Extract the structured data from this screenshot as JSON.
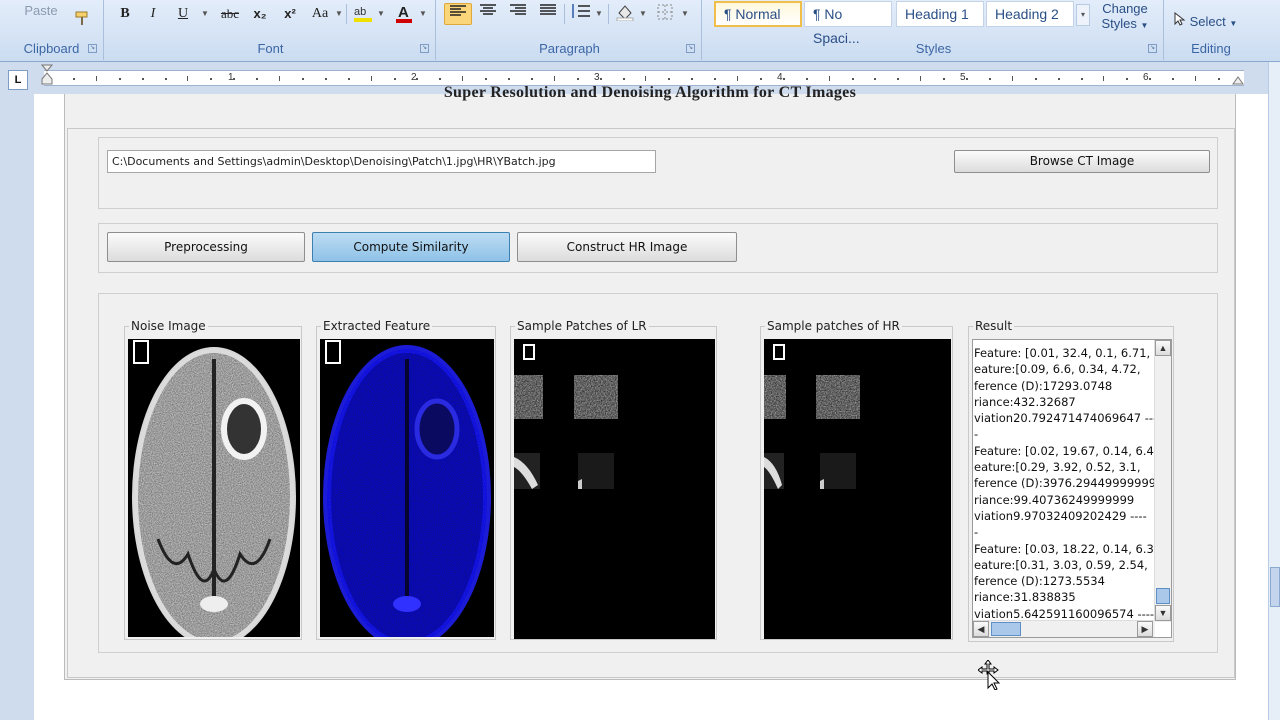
{
  "ribbon": {
    "clipboard": {
      "label": "Clipboard",
      "paste": "Paste"
    },
    "font": {
      "label": "Font",
      "bold": "B",
      "italic": "I",
      "underline": "U",
      "strike": "abc",
      "subscript": "x₂",
      "superscript": "x²",
      "change_case": "Aa"
    },
    "paragraph": {
      "label": "Paragraph"
    },
    "styles": {
      "label": "Styles",
      "items": [
        "¶ Normal",
        "¶ No Spaci...",
        "Heading 1",
        "Heading 2"
      ],
      "change_styles": "Change Styles"
    },
    "editing": {
      "label": "Editing",
      "select": "Select"
    }
  },
  "ruler": {
    "tab_marker": "L",
    "numbers": [
      "1",
      "2",
      "3",
      "4",
      "5",
      "6"
    ]
  },
  "document": {
    "app_title": "Super Resolution and Denoising Algorithm for CT Images",
    "path_value": "C:\\Documents and Settings\\admin\\Desktop\\Denoising\\Patch\\1.jpg\\HR\\YBatch.jpg",
    "browse_button": "Browse CT Image",
    "steps": [
      "Preprocessing",
      "Compute Similarity",
      "Construct HR Image"
    ],
    "selected_step": "Compute Similarity",
    "groups": {
      "noise": "Noise Image",
      "feature": "Extracted Feature",
      "lr": "Sample Patches of LR",
      "hr": "Sample patches of HR",
      "result": "Result"
    },
    "result_lines": [
      "Feature: [0.01, 32.4, 0.1, 6.71,",
      "eature:[0.09, 6.6, 0.34, 4.72,",
      "ference (D):17293.0748",
      "riance:432.32687",
      "viation20.792471474069647 ---",
      "-",
      "Feature: [0.02, 19.67, 0.14, 6.4",
      "eature:[0.29, 3.92, 0.52, 3.1,",
      "ference (D):3976.29449999999",
      "riance:99.40736249999999",
      "viation9.97032409202429 ----",
      "-",
      "Feature: [0.03, 18.22, 0.14, 6.3",
      "eature:[0.31, 3.03, 0.59, 2.54,",
      "ference (D):1273.5534",
      "riance:31.838835",
      "viation5.642591160096574 ----"
    ]
  },
  "colors": {
    "ribbon_bg": "#dbe7f7",
    "selected_button": "#9ccbeb",
    "feature_blue": "#1a1ad8"
  }
}
